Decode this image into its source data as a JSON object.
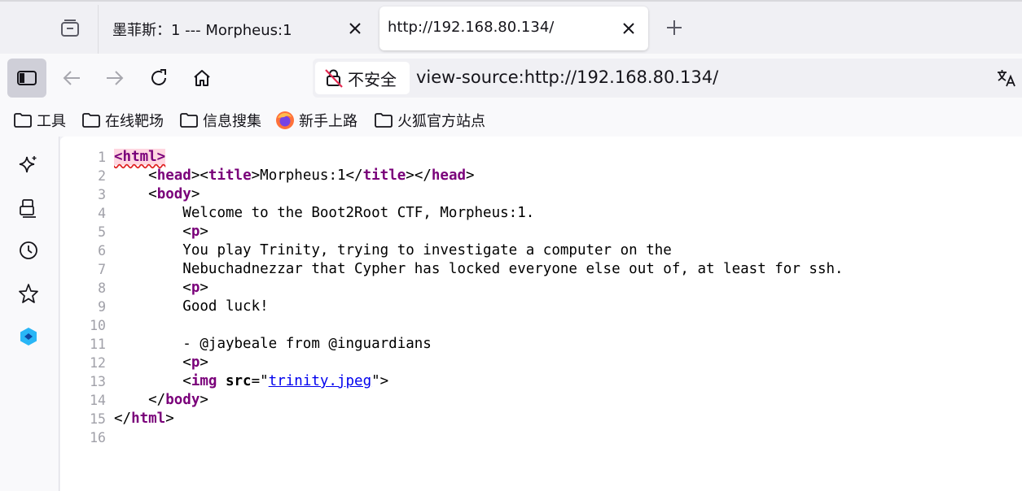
{
  "tabs": [
    {
      "title": "墨菲斯：1 --- Morpheus:1",
      "active": false
    },
    {
      "title": "http://192.168.80.134/",
      "active": true
    }
  ],
  "navbar": {
    "security_label": "不安全",
    "url": "view-source:http://192.168.80.134/"
  },
  "bookmarks": [
    {
      "label": "工具",
      "icon": "folder-icon"
    },
    {
      "label": "在线靶场",
      "icon": "folder-icon"
    },
    {
      "label": "信息搜集",
      "icon": "folder-icon"
    },
    {
      "label": "新手上路",
      "icon": "firefox-icon"
    },
    {
      "label": "火狐官方站点",
      "icon": "folder-icon"
    }
  ],
  "sidebar": [
    "ai-sparkle-icon",
    "synced-tabs-icon",
    "history-icon",
    "bookmarks-star-icon",
    "extension-icon"
  ],
  "source": {
    "line_numbers": [
      "1",
      "2",
      "3",
      "4",
      "5",
      "6",
      "7",
      "8",
      "9",
      "10",
      "11",
      "12",
      "13",
      "14",
      "15",
      "16"
    ],
    "welcome": "Welcome to the Boot2Root CTF, Morpheus:1.",
    "intro1": "You play Trinity, trying to investigate a computer on the",
    "intro2": "Nebuchadnezzar that Cypher has locked everyone else out of, at least for ssh.",
    "goodluck": "Good luck!",
    "signature": "- @jaybeale from @inguardians",
    "title_text": "Morpheus:1",
    "img_src": "trinity.jpeg"
  }
}
